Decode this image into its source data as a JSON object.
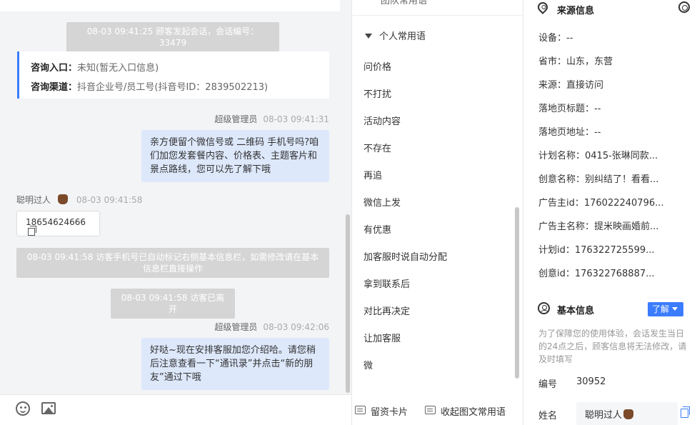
{
  "chat": {
    "sys_session_start": "08-03 09:41:25 顾客发起会话，会话编号：33479",
    "entry_card": {
      "entrance_label": "咨询入口：",
      "entrance_value": "未知(暂无入口信息)",
      "channel_label": "咨询渠道：",
      "channel_value": "抖音企业号/员工号(抖音号ID：2839502213)"
    },
    "msg1": {
      "sender": "超级管理员",
      "time": "08-03 09:41:31",
      "text": "亲方便留个微信号或 二维码 手机号吗?咱们加您发套餐内容、价格表、主题客片和景点路线，您可以先了解下哦"
    },
    "msg2": {
      "sender": "聪明过人",
      "time": "08-03 09:41:58",
      "text": "18654624666"
    },
    "sys_phone_marked": "08-03 09:41:58 访客手机号已自动标记右侧基本信息栏，如需修改请在基本信息栏直接操作",
    "sys_visitor_left": "08-03 09:41:58 访客已离开",
    "msg3": {
      "sender": "超级管理员",
      "time": "08-03 09:42:06",
      "text": "好哒~现在安排客服加您介绍哈。请您稍后注意查看一下“通讯录”并点击“新的朋友”通过下哦"
    }
  },
  "phrases": {
    "top_label": "团队常用语",
    "group_title": "个人常用语",
    "items": [
      "问价格",
      "不打扰",
      "活动内容",
      "不存在",
      "再追",
      "微信上发",
      "有优惠",
      "加客服时说自动分配",
      "拿到联系后",
      "对比再决定",
      "让加客服",
      "微"
    ],
    "card_button": "留资卡片",
    "rich_button": "收起图文常用语"
  },
  "source_info": {
    "title": "来源信息",
    "rows": [
      "设备：--",
      "省市：山东，东营",
      "来源：直接访问",
      "落地页标题：--",
      "落地页地址：--",
      "计划名称：0415-张琳同款...",
      "创意名称：别纠结了！看看...",
      "广告主id：176022240796...",
      "广告主名称：提米映画婚前...",
      "计划id：176322725599...",
      "创意id：176322768887..."
    ]
  },
  "basic_info": {
    "title": "基本信息",
    "learn_more": "了解",
    "notice": "为了保障您的使用体验，会话发生当日的24点之后，顾客信息将无法修改，请及时填写",
    "id_label": "编号",
    "id_value": "30952",
    "name_label": "姓名",
    "name_value": "聪明过人"
  },
  "icons": {
    "emoji": "emoji-icon",
    "image": "image-icon",
    "location": "location-pin-icon",
    "settings": "settings-icon",
    "user": "user-circle-icon",
    "copy": "copy-icon",
    "edit": "edit-icon"
  },
  "colors": {
    "accent": "#3b7cff",
    "bubble": "#dde8fb",
    "system_message": "#d5d5d5"
  }
}
